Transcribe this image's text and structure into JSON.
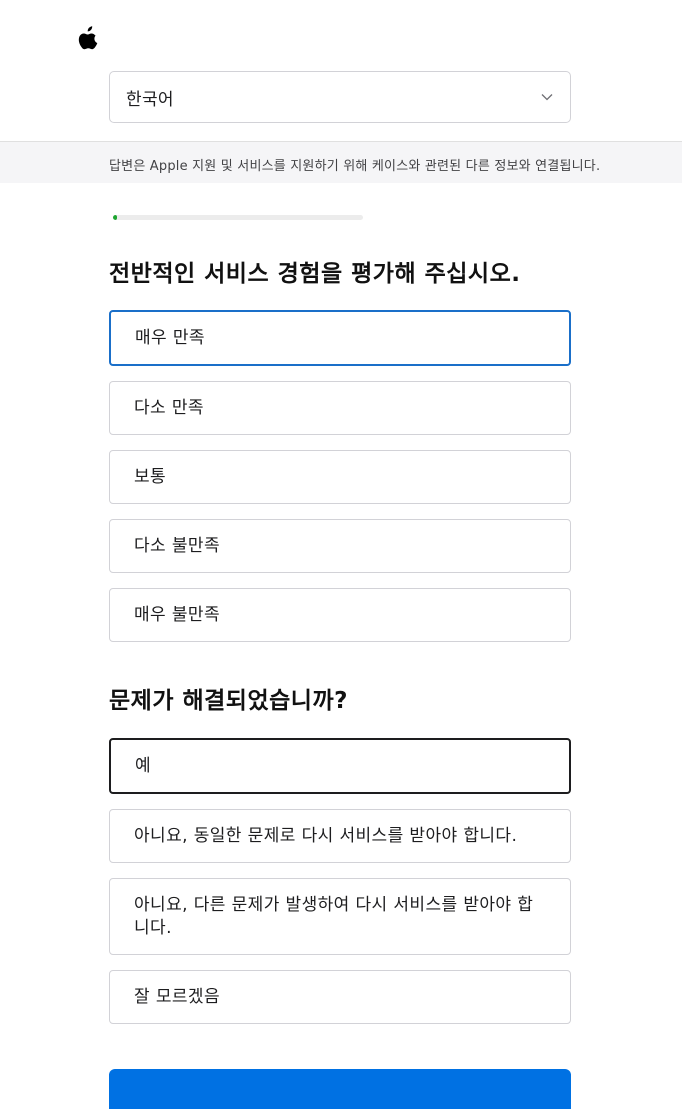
{
  "header": {
    "logo": "apple-logo"
  },
  "language_select": {
    "value": "한국어",
    "icon": "chevron-down-icon"
  },
  "notice": {
    "text": "답변은 Apple 지원 및 서비스를 지원하기 위해 케이스와 관련된 다른 정보와 연결됩니다."
  },
  "progress": {
    "fraction": 0.015,
    "color": "#1da52f"
  },
  "questions": [
    {
      "title": "전반적인 서비스 경험을 평가해 주십시오.",
      "options": [
        "매우 만족",
        "다소 만족",
        "보통",
        "다소 불만족",
        "매우 불만족"
      ]
    },
    {
      "title": "문제가 해결되었습니까?",
      "options": [
        "예",
        "아니요, 동일한 문제로 다시 서비스를 받아야 합니다.",
        "아니요, 다른 문제가 발생하여 다시 서비스를 받아야 합니다.",
        "잘 모르겠음"
      ]
    }
  ],
  "colors": {
    "accent": "#0071e3",
    "focus_blue": "#1a6fc9"
  }
}
